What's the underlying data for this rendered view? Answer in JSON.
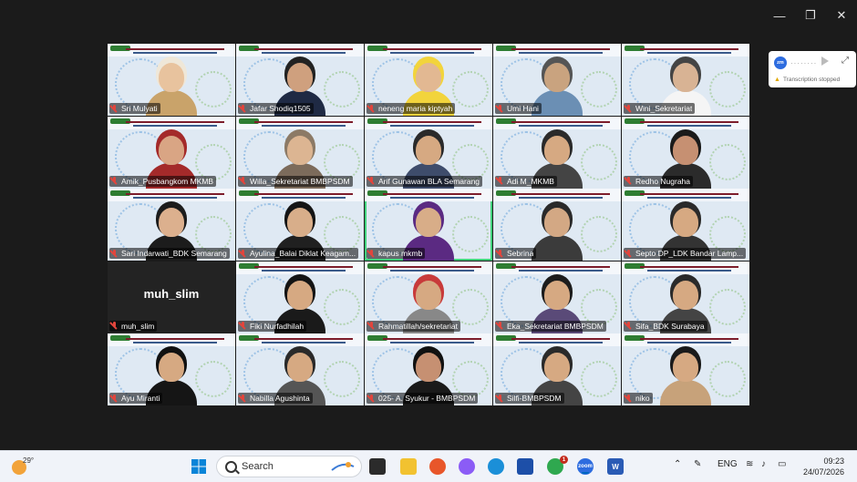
{
  "window_controls": {
    "minimize": "—",
    "restore": "❐",
    "close": "✕"
  },
  "participants": [
    {
      "name": "Sri Mulyati",
      "skin": "#e8c39e",
      "hair": "#efe7d8",
      "shirt": "#c9a36a"
    },
    {
      "name": "Jafar Shodiq1505",
      "skin": "#cfa07e",
      "hair": "#222",
      "shirt": "#1f2a44"
    },
    {
      "name": "neneng maria kiptyah",
      "skin": "#e2b892",
      "hair": "#f2d43c",
      "shirt": "#f2d43c"
    },
    {
      "name": "Umi Hani",
      "skin": "#c9a37f",
      "hair": "#555",
      "shirt": "#6b8fb4"
    },
    {
      "name": "Wini_Sekretariat",
      "skin": "#d8b394",
      "hair": "#444",
      "shirt": "#f5f5f5"
    },
    {
      "name": "Amik_Pusbangkom MKMB",
      "skin": "#d9a584",
      "hair": "#a42a2a",
      "shirt": "#a42a2a"
    },
    {
      "name": "Willa_Sekretariat BMBPSDM",
      "skin": "#dcb592",
      "hair": "#8c7a66",
      "shirt": "#7c6b5b"
    },
    {
      "name": "Arif Gunawan BLA Semarang",
      "skin": "#d6a982",
      "hair": "#2a2a2a",
      "shirt": "#3e4c6b"
    },
    {
      "name": "Adi M_MKMB",
      "skin": "#d6a982",
      "hair": "#2a2a2a",
      "shirt": "#444"
    },
    {
      "name": "Redho Nugraha",
      "skin": "#c69072",
      "hair": "#1a1a1a",
      "shirt": "#2b2b2b"
    },
    {
      "name": "Sari Indarwati_BDK Semarang",
      "skin": "#dcb08e",
      "hair": "#1c1c1c",
      "shirt": "#1c1c1c"
    },
    {
      "name": "Ayulina_Balai Diklat Keagam...",
      "skin": "#d8ae8a",
      "hair": "#151515",
      "shirt": "#202020"
    },
    {
      "name": "kapus mkmb",
      "skin": "#d8ad88",
      "hair": "#5b2a82",
      "shirt": "#5b2a82"
    },
    {
      "name": "Sebrina",
      "skin": "#d3a884",
      "hair": "#2a2a2a",
      "shirt": "#3b3b3b"
    },
    {
      "name": "Septo DP_LDK Bandar Lamp...",
      "skin": "#d6a982",
      "hair": "#2a2a2a",
      "shirt": "#333"
    },
    {
      "name": "muh_slim",
      "skin": "",
      "hair": "",
      "shirt": ""
    },
    {
      "name": "Fiki Nurfadhilah",
      "skin": "#d6a982",
      "hair": "#141414",
      "shirt": "#1a1a1a"
    },
    {
      "name": "Rahmatillah/sekretariat",
      "skin": "#d6a982",
      "hair": "#c83a3a",
      "shirt": "#888"
    },
    {
      "name": "Eka_Sekretariat BMBPSDM",
      "skin": "#d6a982",
      "hair": "#1c1c1c",
      "shirt": "#5a4a78"
    },
    {
      "name": "Sifa_BDK Surabaya",
      "skin": "#d6a982",
      "hair": "#2a2a2a",
      "shirt": "#444"
    },
    {
      "name": "Ayu Miranti",
      "skin": "#d6a982",
      "hair": "#111",
      "shirt": "#151515"
    },
    {
      "name": "Nabilla Agushinta",
      "skin": "#d6a982",
      "hair": "#2a2a2a",
      "shirt": "#555"
    },
    {
      "name": "025- A. Syukur - BMBPSDM",
      "skin": "#c69072",
      "hair": "#111",
      "shirt": "#1a1a1a"
    },
    {
      "name": "Silfi-BMBPSDM",
      "skin": "#d6a982",
      "hair": "#2a2a2a",
      "shirt": "#444"
    },
    {
      "name": "niko",
      "skin": "#d6a982",
      "hair": "#1a1a1a",
      "shirt": "#c7a27a"
    }
  ],
  "muh_slim_display": "muh_slim",
  "transcription": {
    "logo": "zm",
    "status": "Transcription stopped"
  },
  "taskbar": {
    "temperature": "29°",
    "search_placeholder": "Search",
    "language": "ENG",
    "time": "09:23",
    "date": "24/07/2026",
    "notification_count": "1"
  },
  "colors": {
    "active_speaker": "#3fd07a",
    "muted_mic": "#e2453c"
  }
}
